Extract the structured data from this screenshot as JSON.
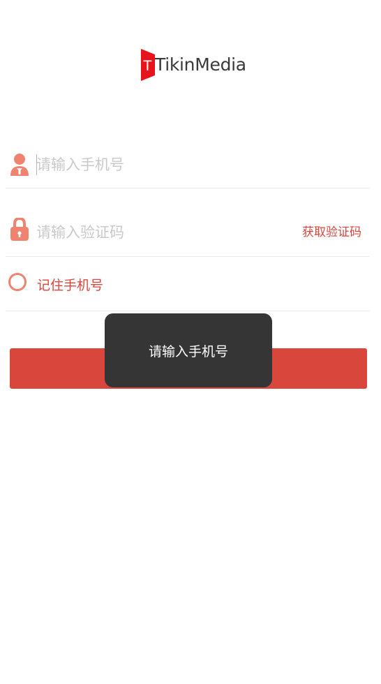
{
  "logo": {
    "text": "TikinMedia",
    "mark_color": "#e8141b"
  },
  "form": {
    "phone": {
      "placeholder": "请输入手机号",
      "value": "",
      "icon": "user-icon"
    },
    "code": {
      "placeholder": "请输入验证码",
      "value": "",
      "icon": "lock-icon",
      "get_code_label": "获取验证码"
    },
    "remember": {
      "label": "记住手机号",
      "checked": false
    },
    "login_label": ""
  },
  "toast": {
    "message": "请输入手机号"
  },
  "colors": {
    "accent": "#d9473c",
    "icon": "#f08270",
    "toast_bg": "#353535"
  }
}
